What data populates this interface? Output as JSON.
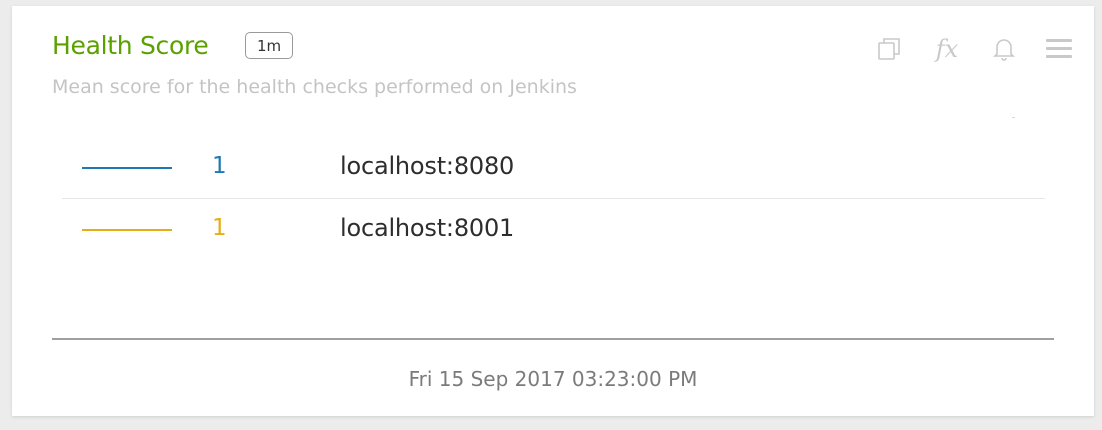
{
  "panel": {
    "title": "Health Score",
    "interval": "1m",
    "description": "Mean score for the health checks performed on Jenkins",
    "title_color": "#5aa100"
  },
  "toolbar": {
    "copy_icon": "copy-icon",
    "fx_label": "fx",
    "alert_icon": "bell-icon",
    "menu_icon": "hamburger-menu-icon"
  },
  "legend": [
    {
      "value": "1",
      "label": "localhost:8080",
      "color": "#1f78b4"
    },
    {
      "value": "1",
      "label": "localhost:8001",
      "color": "#e5ad18"
    }
  ],
  "footer": {
    "timestamp": "Fri 15 Sep 2017 03:23:00 PM"
  }
}
